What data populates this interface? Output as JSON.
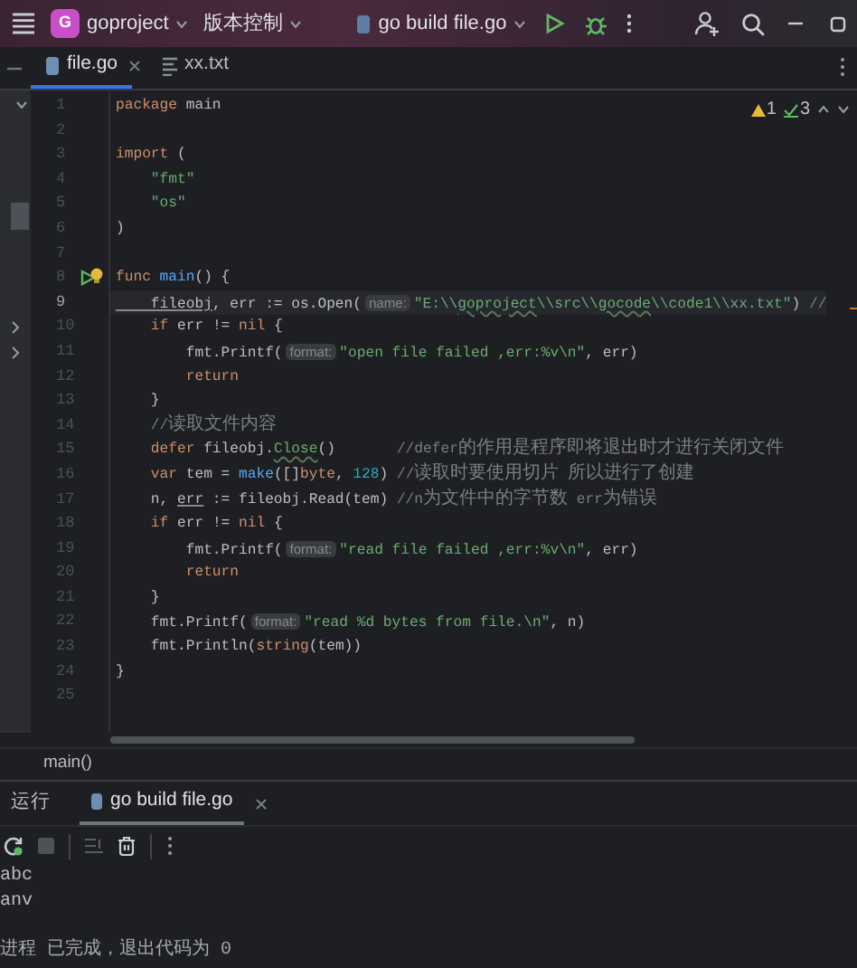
{
  "title_bar": {
    "project_initial": "G",
    "project": "goproject",
    "vcs": "版本控制",
    "run_config": "go build file.go"
  },
  "editor_tabs": [
    {
      "label": "file.go",
      "kind": "go",
      "selected": true,
      "closable": true
    },
    {
      "label": "xx.txt",
      "kind": "text",
      "selected": false,
      "closable": false
    }
  ],
  "inspections": {
    "warnings": "1",
    "passed": "3"
  },
  "lines": [
    {
      "number": "1",
      "current": false,
      "run_marker": false,
      "tokens": [
        {
          "kind": "kw",
          "text": "package"
        },
        {
          "kind": "plain",
          "text": " main"
        }
      ]
    },
    {
      "number": "2",
      "current": false,
      "run_marker": false
    },
    {
      "number": "3",
      "current": false,
      "run_marker": false,
      "tokens": [
        {
          "kind": "kw",
          "text": "import"
        },
        {
          "kind": "plain",
          "text": " ("
        }
      ]
    },
    {
      "number": "4",
      "current": false,
      "run_marker": false,
      "tokens": [
        {
          "kind": "str",
          "text": "    \"fmt\""
        }
      ]
    },
    {
      "number": "5",
      "current": false,
      "run_marker": false,
      "tokens": [
        {
          "kind": "str",
          "text": "    \"os\""
        }
      ]
    },
    {
      "number": "6",
      "current": false,
      "run_marker": false,
      "tokens": [
        {
          "kind": "plain",
          "text": ")"
        }
      ]
    },
    {
      "number": "7",
      "current": false,
      "run_marker": false
    },
    {
      "number": "8",
      "current": false,
      "run_marker": true,
      "tokens": [
        {
          "kind": "kw",
          "text": "func"
        },
        {
          "kind": "fn",
          "text": " main"
        },
        {
          "kind": "plain",
          "text": "() {"
        }
      ]
    },
    {
      "number": "9",
      "current": true,
      "run_marker": false,
      "tokens": [
        {
          "kind": "under",
          "text": "    fileobj"
        },
        {
          "kind": "plain",
          "text": ", err := os.Open("
        },
        {
          "kind": "hint",
          "text": "name:"
        },
        {
          "kind": "str",
          "text": "\"E:\\\\"
        },
        {
          "kind": "typo",
          "text": "goproject"
        },
        {
          "kind": "str",
          "text": "\\\\src\\\\"
        },
        {
          "kind": "typo",
          "text": "gocode"
        },
        {
          "kind": "str",
          "text": "\\\\code1\\\\xx.txt\""
        },
        {
          "kind": "plain",
          "text": ") "
        },
        {
          "kind": "cmt",
          "text": "//"
        }
      ]
    },
    {
      "number": "10",
      "current": false,
      "run_marker": false,
      "tokens": [
        {
          "kind": "kw",
          "text": "    if"
        },
        {
          "kind": "plain",
          "text": " err != "
        },
        {
          "kind": "kw",
          "text": "nil"
        },
        {
          "kind": "plain",
          "text": " {"
        }
      ]
    },
    {
      "number": "11",
      "current": false,
      "run_marker": false,
      "tokens": [
        {
          "kind": "plain",
          "text": "        fmt.Printf("
        },
        {
          "kind": "hint",
          "text": "format:"
        },
        {
          "kind": "str",
          "text": "\"open file failed ,err:%v\\n\""
        },
        {
          "kind": "plain",
          "text": ", err)"
        }
      ]
    },
    {
      "number": "12",
      "current": false,
      "run_marker": false,
      "tokens": [
        {
          "kind": "kw",
          "text": "        return"
        }
      ]
    },
    {
      "number": "13",
      "current": false,
      "run_marker": false,
      "tokens": [
        {
          "kind": "plain",
          "text": "    }"
        }
      ]
    },
    {
      "number": "14",
      "current": false,
      "run_marker": false,
      "tokens": [
        {
          "kind": "cmt",
          "text": "    //读取文件内容"
        }
      ]
    },
    {
      "number": "15",
      "current": false,
      "run_marker": false,
      "tokens": [
        {
          "kind": "kw",
          "text": "    defer"
        },
        {
          "kind": "plain",
          "text": " fileobj."
        },
        {
          "kind": "typo",
          "text": "Close"
        },
        {
          "kind": "plain",
          "text": "()       "
        },
        {
          "kind": "cmt",
          "text": "//defer的作用是程序即将退出时才进行关闭文件"
        }
      ]
    },
    {
      "number": "16",
      "current": false,
      "run_marker": false,
      "tokens": [
        {
          "kind": "kw",
          "text": "    var"
        },
        {
          "kind": "plain",
          "text": " tem = "
        },
        {
          "kind": "fn",
          "text": "make"
        },
        {
          "kind": "plain",
          "text": "([]"
        },
        {
          "kind": "kw",
          "text": "byte"
        },
        {
          "kind": "plain",
          "text": ", "
        },
        {
          "kind": "num",
          "text": "128"
        },
        {
          "kind": "plain",
          "text": ") "
        },
        {
          "kind": "cmt",
          "text": "//读取时要使用切片 所以进行了创建"
        }
      ]
    },
    {
      "number": "17",
      "current": false,
      "run_marker": false,
      "tokens": [
        {
          "kind": "plain",
          "text": "    n, "
        },
        {
          "kind": "under",
          "text": "err"
        },
        {
          "kind": "plain",
          "text": " := fileobj.Read(tem) "
        },
        {
          "kind": "cmt",
          "text": "//n为文件中的字节数 err为错误"
        }
      ]
    },
    {
      "number": "18",
      "current": false,
      "run_marker": false,
      "tokens": [
        {
          "kind": "kw",
          "text": "    if"
        },
        {
          "kind": "plain",
          "text": " err != "
        },
        {
          "kind": "kw",
          "text": "nil"
        },
        {
          "kind": "plain",
          "text": " {"
        }
      ]
    },
    {
      "number": "19",
      "current": false,
      "run_marker": false,
      "tokens": [
        {
          "kind": "plain",
          "text": "        fmt.Printf("
        },
        {
          "kind": "hint",
          "text": "format:"
        },
        {
          "kind": "str",
          "text": "\"read file failed ,err:%v\\n\""
        },
        {
          "kind": "plain",
          "text": ", err)"
        }
      ]
    },
    {
      "number": "20",
      "current": false,
      "run_marker": false,
      "tokens": [
        {
          "kind": "kw",
          "text": "        return"
        }
      ]
    },
    {
      "number": "21",
      "current": false,
      "run_marker": false,
      "tokens": [
        {
          "kind": "plain",
          "text": "    }"
        }
      ]
    },
    {
      "number": "22",
      "current": false,
      "run_marker": false,
      "tokens": [
        {
          "kind": "plain",
          "text": "    fmt.Printf("
        },
        {
          "kind": "hint",
          "text": "format:"
        },
        {
          "kind": "str",
          "text": "\"read %d bytes from file.\\n\""
        },
        {
          "kind": "plain",
          "text": ", n)"
        }
      ]
    },
    {
      "number": "23",
      "current": false,
      "run_marker": false,
      "tokens": [
        {
          "kind": "plain",
          "text": "    fmt.Println("
        },
        {
          "kind": "kw",
          "text": "string"
        },
        {
          "kind": "plain",
          "text": "(tem))"
        }
      ]
    },
    {
      "number": "24",
      "current": false,
      "run_marker": false,
      "tokens": [
        {
          "kind": "plain",
          "text": "}"
        }
      ]
    },
    {
      "number": "25",
      "current": false,
      "run_marker": false
    }
  ],
  "breadcrumb": "main()",
  "run_panel": {
    "title": "运行",
    "tabs": [
      {
        "label": "go build file.go",
        "selected": true
      }
    ],
    "output": [
      {
        "kind": "out",
        "text": "abc"
      },
      {
        "kind": "out",
        "text": "anv"
      },
      {
        "kind": "exit",
        "text": "进程 已完成，退出代码为 0"
      }
    ]
  }
}
